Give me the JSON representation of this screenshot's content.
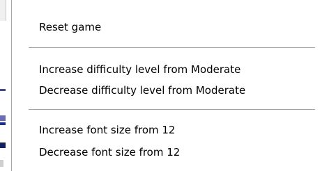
{
  "context_menu": {
    "items": [
      {
        "label": "Reset game"
      },
      {
        "label": "Increase difficulty level from Moderate"
      },
      {
        "label": "Decrease difficulty level from Moderate"
      },
      {
        "label": "Increase font size from 12"
      },
      {
        "label": "Decrease font size from 12"
      }
    ]
  }
}
